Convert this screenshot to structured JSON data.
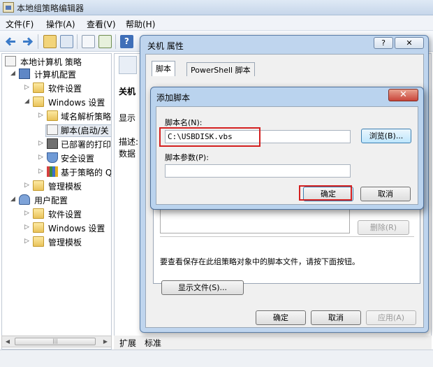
{
  "window": {
    "title": "本地组策略编辑器"
  },
  "menu": [
    "文件(F)",
    "操作(A)",
    "查看(V)",
    "帮助(H)"
  ],
  "tree": {
    "items": [
      {
        "label": "本地计算机 策略",
        "icon": "policy-icon",
        "level": 0
      },
      {
        "label": "计算机配置",
        "icon": "computer-icon",
        "level": 1
      },
      {
        "label": "软件设置",
        "icon": "folder-icon",
        "level": 2
      },
      {
        "label": "Windows 设置",
        "icon": "folder-icon",
        "level": 2
      },
      {
        "label": "域名解析策略",
        "icon": "folder-icon",
        "level": 3
      },
      {
        "label": "脚本(启动/关",
        "icon": "script-icon",
        "level": 3
      },
      {
        "label": "已部署的打印",
        "icon": "printer-icon",
        "level": 3
      },
      {
        "label": "安全设置",
        "icon": "security-icon",
        "level": 3
      },
      {
        "label": "基于策略的 Q",
        "icon": "chart-icon",
        "level": 3
      },
      {
        "label": "管理模板",
        "icon": "folder-icon",
        "level": 2
      },
      {
        "label": "用户配置",
        "icon": "users-icon",
        "level": 1
      },
      {
        "label": "软件设置",
        "icon": "folder-icon",
        "level": 2
      },
      {
        "label": "Windows 设置",
        "icon": "folder-icon",
        "level": 2
      },
      {
        "label": "管理模板",
        "icon": "folder-icon",
        "level": 2
      }
    ]
  },
  "right_pane": {
    "heading": "关机",
    "show_label": "显示",
    "desc_label": "描述:",
    "desc_label2": "数据",
    "bottom_tabs": [
      "扩展",
      "标准"
    ]
  },
  "props_dialog": {
    "title": "关机 属性",
    "help": "?",
    "tabs": [
      "脚本",
      "PowerShell 脚本"
    ],
    "remove_button": "删除(R)",
    "hint": "要查看保存在此组策略对象中的脚本文件，请按下面按钮。",
    "show_files_button": "显示文件(S)...",
    "ok": "确定",
    "cancel": "取消",
    "apply": "应用(A)"
  },
  "add_dialog": {
    "title": "添加脚本",
    "script_name_label": "脚本名(N):",
    "script_name_value": "C:\\USBDISK.vbs",
    "browse_button": "浏览(B)...",
    "params_label": "脚本参数(P):",
    "params_value": "",
    "ok": "确定",
    "cancel": "取消"
  }
}
